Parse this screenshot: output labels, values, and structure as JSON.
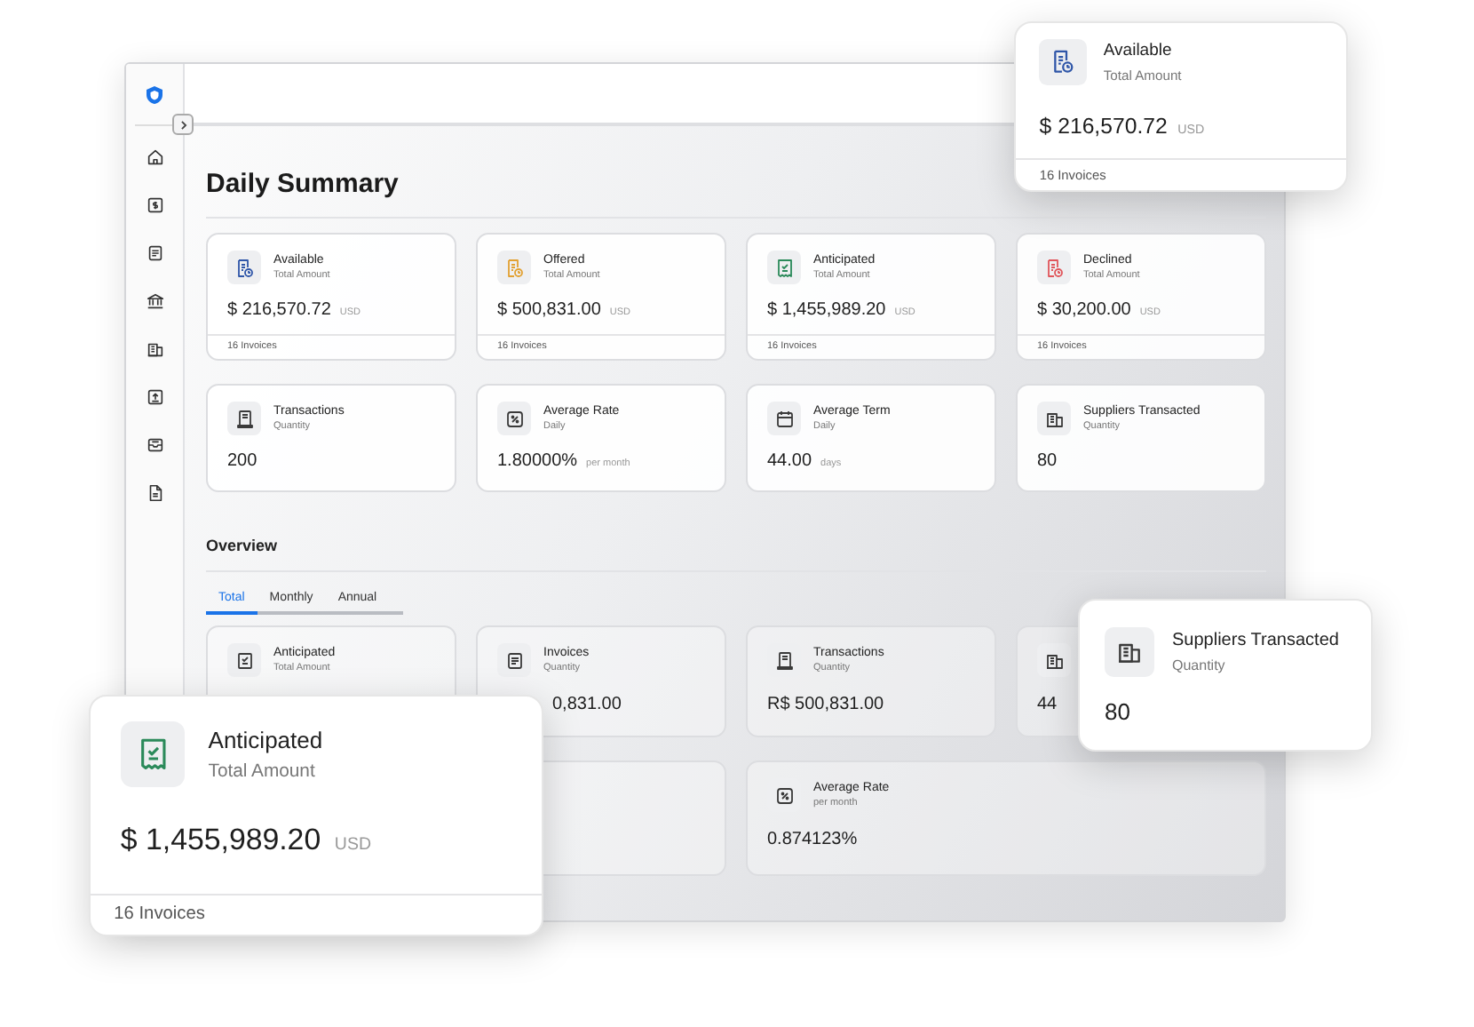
{
  "page": {
    "title": "Daily Summary"
  },
  "summary_cards": [
    {
      "title": "Available",
      "subtitle": "Total Amount",
      "value": "$ 216,570.72",
      "unit": "USD",
      "footer": "16 Invoices",
      "color": "#2f56a8"
    },
    {
      "title": "Offered",
      "subtitle": "Total Amount",
      "value": "$ 500,831.00",
      "unit": "USD",
      "footer": "16 Invoices",
      "color": "#e2a132"
    },
    {
      "title": "Anticipated",
      "subtitle": "Total Amount",
      "value": "$ 1,455,989.20",
      "unit": "USD",
      "footer": "16 Invoices",
      "color": "#2b8a5a"
    },
    {
      "title": "Declined",
      "subtitle": "Total Amount",
      "value": "$ 30,200.00",
      "unit": "USD",
      "footer": "16 Invoices",
      "color": "#e0565b"
    },
    {
      "title": "Transactions",
      "subtitle": "Quantity",
      "value": "200",
      "color": "#3a3a3a"
    },
    {
      "title": "Average Rate",
      "subtitle": "Daily",
      "value": "1.80000%",
      "unit": "per month",
      "color": "#3a3a3a"
    },
    {
      "title": "Average Term",
      "subtitle": "Daily",
      "value": "44.00",
      "unit": "days",
      "color": "#3a3a3a"
    },
    {
      "title": "Suppliers Transacted",
      "subtitle": "Quantity",
      "value": "80",
      "color": "#3a3a3a"
    }
  ],
  "overview": {
    "title": "Overview",
    "tabs": [
      {
        "label": "Total",
        "selected": true
      },
      {
        "label": "Monthly",
        "selected": false
      },
      {
        "label": "Annual",
        "selected": false
      }
    ],
    "cards": [
      {
        "kind": "metric",
        "title": "Anticipated",
        "subtitle": "Total Amount"
      },
      {
        "kind": "clipped",
        "title": "Invoices",
        "subtitle": "Quantity",
        "value": "0,831.00"
      },
      {
        "kind": "metric",
        "title": "Transactions",
        "subtitle": "Quantity",
        "value": "R$ 500,831.00"
      },
      {
        "kind": "metric",
        "value": "44"
      },
      {
        "kind": "blank"
      },
      {
        "kind": "metric",
        "title": "Average Rate",
        "subtitle": "per month",
        "value": "0.874123%"
      }
    ]
  },
  "floating_cards": [
    {
      "title": "Available",
      "subtitle": "Total Amount",
      "value": "$ 216,570.72",
      "unit": "USD",
      "footer": "16 Invoices",
      "color": "#2f56a8"
    },
    {
      "title": "Anticipated",
      "subtitle": "Total Amount",
      "value": "$ 1,455,989.20",
      "unit": "USD",
      "footer": "16 Invoices",
      "color": "#2b8a5a"
    },
    {
      "title": "Suppliers Transacted",
      "subtitle": "Quantity",
      "value": "80",
      "color": "#3a3a3a"
    }
  ]
}
